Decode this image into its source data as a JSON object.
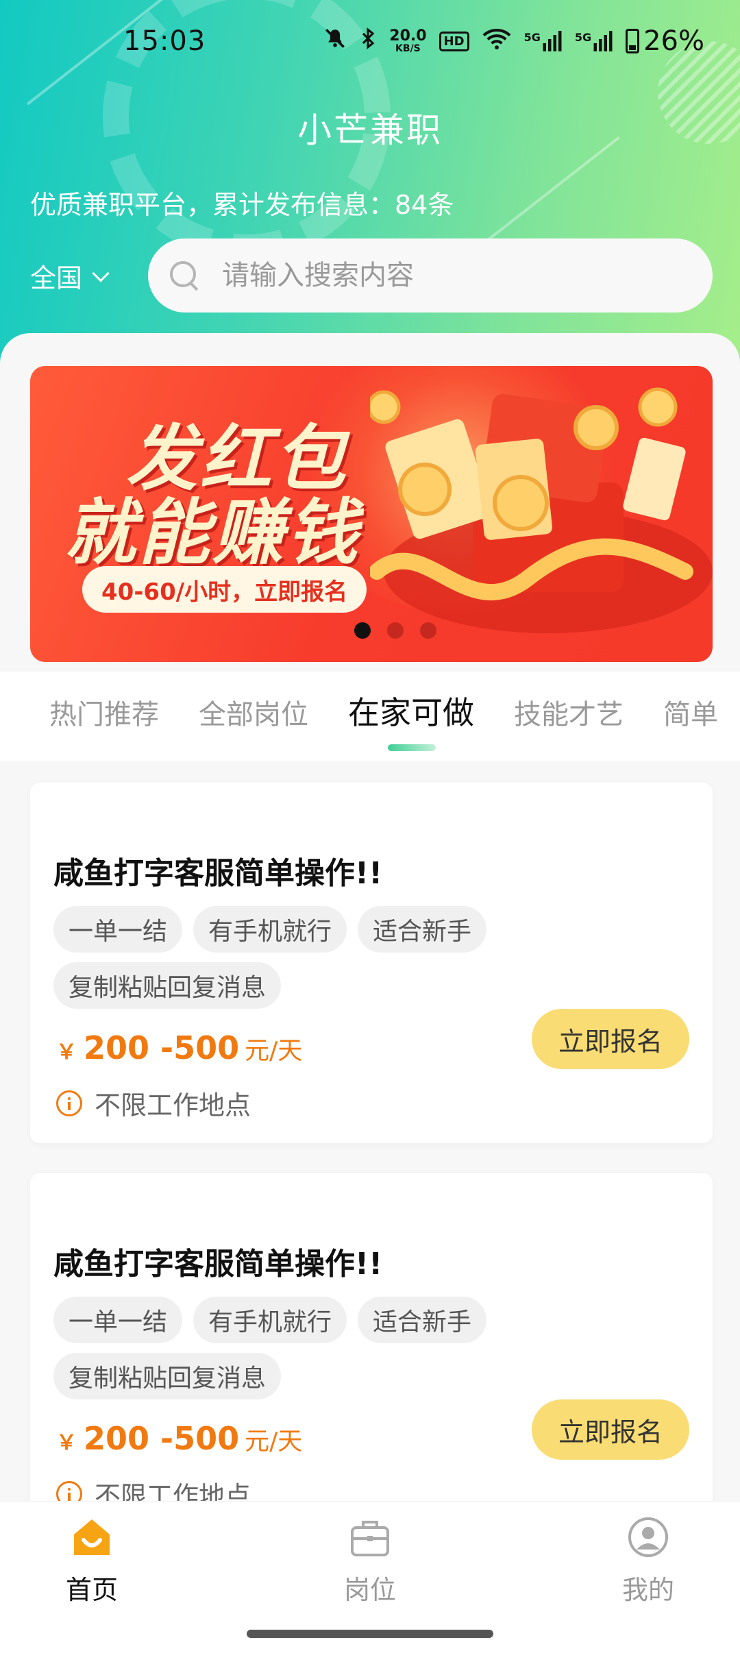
{
  "status_bar": {
    "time": "15:03",
    "speed_value": "20.0",
    "speed_unit": "KB/S",
    "hd": "HD",
    "net1": "5G",
    "net2": "5G",
    "battery": "26%"
  },
  "header": {
    "title": "小芒兼职",
    "subtitle": "优质兼职平台，累计发布信息：84条",
    "region": "全国",
    "search_placeholder": "请输入搜索内容"
  },
  "banner": {
    "line1": "发红包",
    "line2": "就能赚钱",
    "pill": "40-60/小时，立即报名",
    "slide_count": 3,
    "active_slide": 1
  },
  "tabs": [
    "热门推荐",
    "全部岗位",
    "在家可做",
    "技能才艺",
    "简单"
  ],
  "active_tab": 2,
  "jobs": [
    {
      "title": "咸鱼打字客服简单操作!!",
      "tags": [
        "一单一结",
        "有手机就行",
        "适合新手",
        "复制粘贴回复消息"
      ],
      "currency": "￥",
      "salary": "200 -500",
      "salary_unit": "元/天",
      "location": "不限工作地点",
      "apply_label": "立即报名"
    },
    {
      "title": "咸鱼打字客服简单操作!!",
      "tags": [
        "一单一结",
        "有手机就行",
        "适合新手",
        "复制粘贴回复消息"
      ],
      "currency": "￥",
      "salary": "200 -500",
      "salary_unit": "元/天",
      "location": "不限工作地点",
      "apply_label": "立即报名"
    }
  ],
  "bottom_nav": {
    "items": [
      {
        "label": "首页",
        "icon": "home-icon"
      },
      {
        "label": "岗位",
        "icon": "briefcase-icon"
      },
      {
        "label": "我的",
        "icon": "user-icon"
      }
    ],
    "active": 0
  },
  "colors": {
    "accent_orange": "#f07a10",
    "button_yellow": "#f9dc73",
    "banner_red": "#f73b2c",
    "header_teal": "#12c9c2",
    "header_green": "#a6ee8a"
  }
}
